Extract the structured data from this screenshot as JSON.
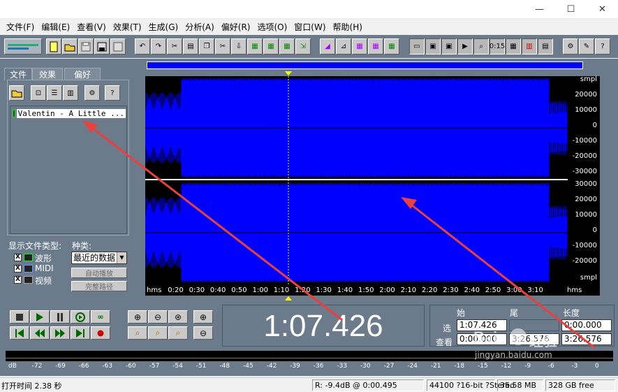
{
  "window": {
    "minimize_glyph": "—",
    "maximize_glyph": "☐",
    "close_glyph": "✕"
  },
  "menu": [
    "文件(F)",
    "编辑(E)",
    "查看(V)",
    "效果(T)",
    "生成(G)",
    "分析(A)",
    "偏好(R)",
    "选项(O)",
    "窗口(W)",
    "帮助(H)"
  ],
  "tabs": {
    "file": "文件",
    "effects": "效果",
    "favorites": "偏好"
  },
  "file_list": {
    "item": "Valentin - A Little ..."
  },
  "file_types": {
    "label": "显示文件类型:",
    "wave": "波形",
    "midi": "MIDI",
    "video": "视频",
    "wave_checked": "X",
    "midi_checked": "X",
    "video_checked": "X"
  },
  "sort": {
    "label": "种类:",
    "selected": "最近的数据",
    "autoplay": "自动播放",
    "fullpath": "完整路径"
  },
  "amplitude_unit": "smpl",
  "amp_ticks_top": [
    "20000",
    "10000",
    "0",
    "-10000",
    "-20000",
    "-30000"
  ],
  "amp_ticks_bottom": [
    "30000",
    "20000",
    "10000",
    "0",
    "-10000",
    "-20000"
  ],
  "amp_unit_bottom": "smpl",
  "time_ticks": [
    "hms",
    "0:20",
    "0:30",
    "0:40",
    "0:50",
    "1:00",
    "1:10",
    "1:20",
    "1:30",
    "1:40",
    "1:50",
    "2:00",
    "2:10",
    "2:20",
    "2:30",
    "2:40",
    "2:50",
    "3:00",
    "3:10",
    "hms"
  ],
  "time_display": "1:07.426",
  "selection": {
    "h_begin": "始",
    "h_end": "尾",
    "h_length": "长度",
    "row_select": "选",
    "row_view": "查看",
    "select_begin": "1:07.426",
    "select_end": "",
    "select_length": "0:00.000",
    "view_begin": "0:00.000",
    "view_end": "3:26.576",
    "view_length": "3:26.576"
  },
  "meter_ticks": [
    "dB",
    "-72",
    "-69",
    "-66",
    "-63",
    "-60",
    "-57",
    "-54",
    "-51",
    "-48",
    "-45",
    "-42",
    "-39",
    "-36",
    "-33",
    "-30",
    "-27",
    "-24",
    "-21",
    "-18",
    "-15",
    "-12",
    "-9",
    "-6",
    "-3",
    "0"
  ],
  "status": {
    "open_time": "打开时间  2.38 秒",
    "cursor": "R: -9.4dB @   0:00.495",
    "format": "44100 ?16-bit ?Stereo",
    "size": "35.58 MB",
    "free": "328 GB free"
  },
  "watermark": {
    "brand": "Bai",
    "brand2": "经验",
    "url": "jingyan.baidu.com"
  },
  "colors": {
    "waveform": "#0000ff",
    "panel": "#6b7b8c",
    "arrow": "#e8413d"
  }
}
